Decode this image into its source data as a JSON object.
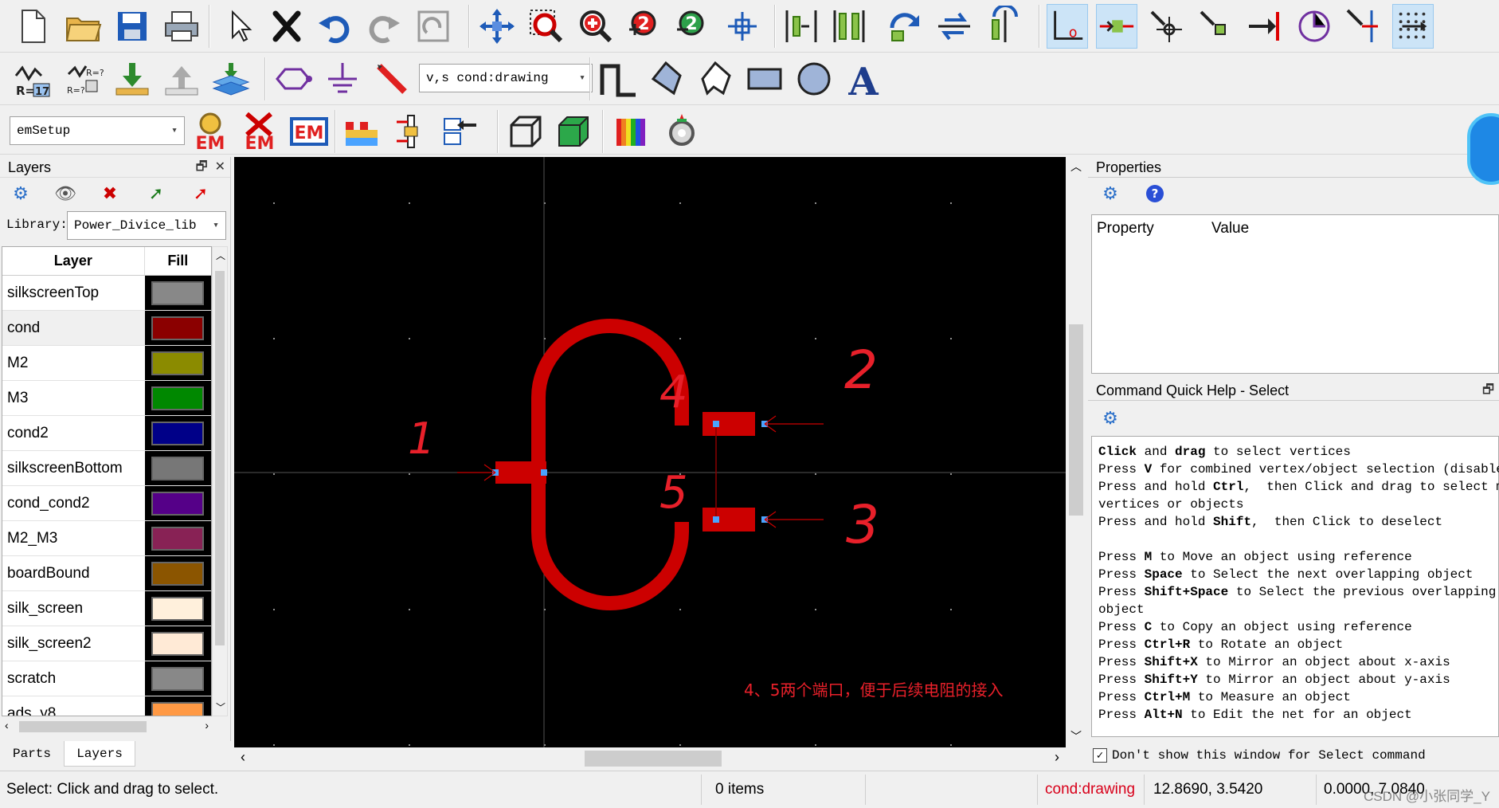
{
  "toolbar1": {
    "icons": [
      "new-file-icon",
      "open-folder-icon",
      "save-icon",
      "print-icon",
      "pointer-select-icon",
      "delete-x-icon",
      "undo-icon",
      "redo-icon",
      "repeat-icon",
      "move-icon",
      "zoom-area-icon",
      "zoom-in-icon",
      "zoom-in-2-icon",
      "zoom-out-2-icon",
      "pan-icon",
      "align-left-icon",
      "align-center-icon",
      "rotate-icon",
      "mirror-icon",
      "flip-icon",
      "snap-origin-icon",
      "snap-midpoint-icon",
      "snap-vertex-icon",
      "snap-edge-icon",
      "snap-pin-icon",
      "snap-center-icon",
      "snap-intersect-icon",
      "grid-snap-icon"
    ]
  },
  "toolbar2": {
    "layer_combo": "v,s cond:drawing",
    "icons": [
      "r17-icon",
      "rf-icon",
      "import-down-icon",
      "export-up-icon",
      "stack-icon",
      "polygon-icon",
      "ground-icon",
      "pencil-icon",
      "path-icon",
      "polygon-draw-icon",
      "arrow-polygon-icon",
      "rectangle-icon",
      "circle-icon",
      "text-icon"
    ]
  },
  "toolbar3": {
    "setup_combo": "emSetup",
    "icons": [
      "em-setup-icon",
      "em-clear-icon",
      "em-icon",
      "substrate-icon",
      "port-icon",
      "port-arrows-icon",
      "3d-wire-icon",
      "3d-solid-icon",
      "rainbow-icon",
      "gear-simulate-icon"
    ]
  },
  "layers_panel": {
    "title": "Layers",
    "library_label": "Library:",
    "library_value": "Power_Divice_lib",
    "col_layer": "Layer",
    "col_fill": "Fill",
    "rows": [
      {
        "name": "silkscreenTop",
        "color": "#888888"
      },
      {
        "name": "cond",
        "color": "#8b0000"
      },
      {
        "name": "M2",
        "color": "#8b8b00"
      },
      {
        "name": "M3",
        "color": "#008800"
      },
      {
        "name": "cond2",
        "color": "#000088"
      },
      {
        "name": "silkscreenBottom",
        "color": "#777777"
      },
      {
        "name": "cond_cond2",
        "color": "#550088"
      },
      {
        "name": "M2_M3",
        "color": "#882255"
      },
      {
        "name": "boardBound",
        "color": "#8b5500"
      },
      {
        "name": "silk_screen",
        "color": "#fff0dc"
      },
      {
        "name": "silk_screen2",
        "color": "#ffead6"
      },
      {
        "name": "scratch",
        "color": "#888888"
      },
      {
        "name": "ads_y8",
        "color": "#ff9944"
      }
    ],
    "tabs": [
      "Parts",
      "Layers"
    ]
  },
  "canvas": {
    "annotations": [
      "1",
      "2",
      "3",
      "4",
      "5"
    ],
    "note": "4、5两个端口，便于后续电阻的接入"
  },
  "properties_panel": {
    "title": "Properties",
    "col_property": "Property",
    "col_value": "Value"
  },
  "help_panel": {
    "title": "Command Quick Help - Select",
    "lines": [
      [
        {
          "b": "Click"
        },
        {
          "t": " and "
        },
        {
          "b": "drag"
        },
        {
          "t": " to select vertices"
        }
      ],
      [
        {
          "t": "Press "
        },
        {
          "b": "V"
        },
        {
          "t": " for combined vertex/object selection (disabled)"
        }
      ],
      [
        {
          "t": "Press and hold "
        },
        {
          "b": "Ctrl"
        },
        {
          "t": ",  then Click and drag to select more"
        }
      ],
      [
        {
          "t": "vertices or objects"
        }
      ],
      [
        {
          "t": "Press and hold "
        },
        {
          "b": "Shift"
        },
        {
          "t": ",  then Click to deselect"
        }
      ],
      [
        {
          "t": ""
        }
      ],
      [
        {
          "t": "Press "
        },
        {
          "b": "M"
        },
        {
          "t": " to Move an object using reference"
        }
      ],
      [
        {
          "t": "Press "
        },
        {
          "b": "Space"
        },
        {
          "t": " to Select the next overlapping object"
        }
      ],
      [
        {
          "t": "Press "
        },
        {
          "b": "Shift+Space"
        },
        {
          "t": " to Select the previous overlapping"
        }
      ],
      [
        {
          "t": "object"
        }
      ],
      [
        {
          "t": "Press "
        },
        {
          "b": "C"
        },
        {
          "t": " to Copy an object using reference"
        }
      ],
      [
        {
          "t": "Press "
        },
        {
          "b": "Ctrl+R"
        },
        {
          "t": " to Rotate an object"
        }
      ],
      [
        {
          "t": "Press "
        },
        {
          "b": "Shift+X"
        },
        {
          "t": " to Mirror an object about x-axis"
        }
      ],
      [
        {
          "t": "Press "
        },
        {
          "b": "Shift+Y"
        },
        {
          "t": " to Mirror an object about y-axis"
        }
      ],
      [
        {
          "t": "Press "
        },
        {
          "b": "Ctrl+M"
        },
        {
          "t": " to Measure an object"
        }
      ],
      [
        {
          "t": "Press "
        },
        {
          "b": "Alt+N"
        },
        {
          "t": " to Edit the net for an object"
        }
      ]
    ],
    "dont_show": "Don't show this window for Select command"
  },
  "statusbar": {
    "message": "Select: Click and drag to select.",
    "items": "0 items",
    "layer": "cond:drawing",
    "coords1": "12.8690, 3.5420",
    "coords2": "0.0000, 7.0840",
    "watermark": "CSDN @小张同学_Y"
  },
  "colors": {
    "conductor": "#cc0000",
    "annotation": "#e8202a",
    "port_marker": "#4aa3ff"
  }
}
